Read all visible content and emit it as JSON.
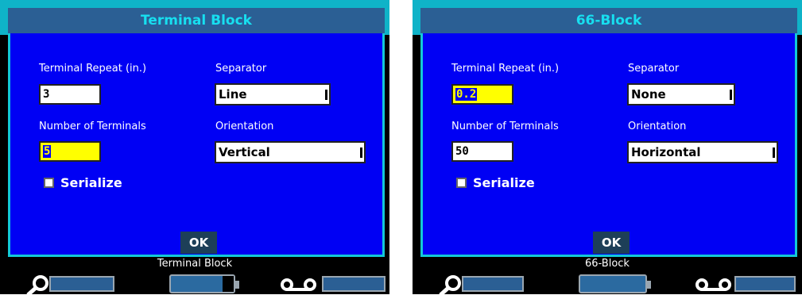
{
  "screens": [
    {
      "title": "Terminal Block",
      "labels": {
        "terminal_repeat": "Terminal Repeat (in.)",
        "separator": "Separator",
        "number_of_terminals": "Number of Terminals",
        "orientation": "Orientation"
      },
      "terminal_repeat_value": "3",
      "number_of_terminals_value": "5",
      "separator_value": "Line",
      "orientation_value": "Vertical",
      "serialize_label": "Serialize",
      "serialize_checked": false,
      "ok_label": "OK",
      "status_text": "Terminal Block",
      "battery_level": 0.85
    },
    {
      "title": "66-Block",
      "labels": {
        "terminal_repeat": "Terminal Repeat (in.)",
        "separator": "Separator",
        "number_of_terminals": "Number of Terminals",
        "orientation": "Orientation"
      },
      "terminal_repeat_value": "0.2",
      "number_of_terminals_value": "50",
      "separator_value": "None",
      "orientation_value": "Horizontal",
      "serialize_label": "Serialize",
      "serialize_checked": false,
      "ok_label": "OK",
      "status_text": "66-Block",
      "battery_level": 1.0
    }
  ],
  "icons": {
    "label_icon": "search-magnifier-icon",
    "battery_icon": "battery-icon",
    "tape_icon": "tape-reel-icon"
  },
  "colors": {
    "dialog_bg": "#0000f4",
    "title_bar": "#2b5f94",
    "title_text": "#17dff0",
    "active_field": "#ffff00"
  }
}
